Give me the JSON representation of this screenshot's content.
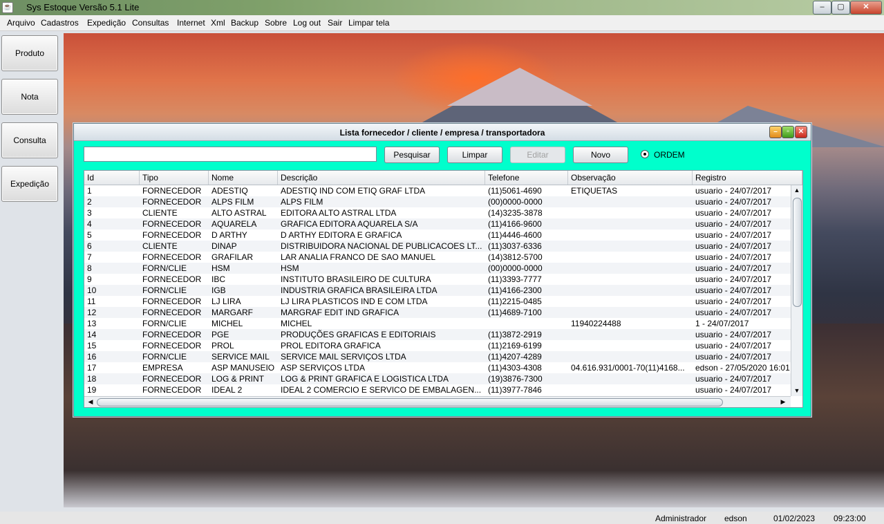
{
  "window": {
    "title": "Sys Estoque Versão 5.1   Lite",
    "icon": "java-icon",
    "controls": {
      "minimize": "–",
      "maximize": "▢",
      "close": "✕"
    }
  },
  "menu": [
    "Arquivo",
    "Cadastros",
    "Expedição",
    "Consultas",
    "Internet",
    "Xml",
    "Backup",
    "Sobre",
    "Log out",
    "Sair",
    "Limpar tela"
  ],
  "sidebar": [
    "Produto",
    "Nota",
    "Consulta",
    "Expedição"
  ],
  "dialog": {
    "title": "Lista fornecedor / cliente / empresa / transportadora",
    "search_value": "",
    "buttons": {
      "pesquisar": "Pesquisar",
      "limpar": "Limpar",
      "editar": "Editar",
      "novo": "Novo"
    },
    "radio_label": "ORDEM",
    "radio_selected": true,
    "background_color": "#00ffcc"
  },
  "table": {
    "columns": [
      "Id",
      "Tipo",
      "Nome",
      "Descrição",
      "Telefone",
      "Observação",
      "Registro"
    ],
    "rows": [
      [
        "1",
        "FORNECEDOR",
        "ADESTIQ",
        "ADESTIQ IND COM ETIQ GRAF LTDA",
        "(11)5061-4690",
        "ETIQUETAS",
        "usuario - 24/07/2017"
      ],
      [
        "2",
        "FORNECEDOR",
        "ALPS FILM",
        "ALPS FILM",
        "(00)0000-0000",
        "",
        "usuario - 24/07/2017"
      ],
      [
        "3",
        "CLIENTE",
        "ALTO ASTRAL",
        "EDITORA ALTO ASTRAL LTDA",
        "(14)3235-3878",
        "",
        "usuario - 24/07/2017"
      ],
      [
        "4",
        "FORNECEDOR",
        "AQUARELA",
        "GRAFICA EDITORA AQUARELA S/A",
        "(11)4166-9600",
        "",
        "usuario - 24/07/2017"
      ],
      [
        "5",
        "FORNECEDOR",
        "D ARTHY",
        "D ARTHY EDITORA E GRAFICA",
        "(11)4446-4600",
        "",
        "usuario - 24/07/2017"
      ],
      [
        "6",
        "CLIENTE",
        "DINAP",
        "DISTRIBUIDORA NACIONAL DE PUBLICACOES LT...",
        "(11)3037-6336",
        "",
        "usuario - 24/07/2017"
      ],
      [
        "7",
        "FORNECEDOR",
        "GRAFILAR",
        "LAR ANALIA FRANCO DE SAO MANUEL",
        "(14)3812-5700",
        "",
        "usuario - 24/07/2017"
      ],
      [
        "8",
        "FORN/CLIE",
        "HSM",
        "HSM",
        "(00)0000-0000",
        "",
        "usuario - 24/07/2017"
      ],
      [
        "9",
        "FORNECEDOR",
        "IBC",
        "INSTITUTO  BRASILEIRO DE CULTURA",
        "(11)3393-7777",
        "",
        "usuario - 24/07/2017"
      ],
      [
        "10",
        "FORN/CLIE",
        "IGB",
        "INDUSTRIA GRAFICA BRASILEIRA LTDA",
        "(11)4166-2300",
        "",
        "usuario - 24/07/2017"
      ],
      [
        "11",
        "FORNECEDOR",
        "LJ LIRA",
        "LJ LIRA  PLASTICOS IND E COM LTDA",
        "(11)2215-0485",
        "",
        "usuario - 24/07/2017"
      ],
      [
        "12",
        "FORNECEDOR",
        "MARGARF",
        "MARGRAF EDIT IND GRAFICA",
        "(11)4689-7100",
        "",
        "usuario - 24/07/2017"
      ],
      [
        "13",
        "FORN/CLIE",
        "MICHEL",
        "MICHEL",
        "",
        "11940224488",
        "1 - 24/07/2017"
      ],
      [
        "14",
        "FORNECEDOR",
        "PGE",
        "PRODUÇÕES GRAFICAS E EDITORIAIS",
        "(11)3872-2919",
        "",
        "usuario - 24/07/2017"
      ],
      [
        "15",
        "FORNECEDOR",
        "PROL",
        "PROL EDITORA GRAFICA",
        "(11)2169-6199",
        "",
        "usuario - 24/07/2017"
      ],
      [
        "16",
        "FORN/CLIE",
        "SERVICE MAIL",
        "SERVICE MAIL SERVIÇOS LTDA",
        "(11)4207-4289",
        "",
        "usuario - 24/07/2017"
      ],
      [
        "17",
        "EMPRESA",
        "ASP MANUSEIO",
        "ASP SERVIÇOS LTDA",
        "(11)4303-4308",
        "04.616.931/0001-70(11)4168...",
        "edson - 27/05/2020 16:01"
      ],
      [
        "18",
        "FORNECEDOR",
        "LOG & PRINT",
        "LOG & PRINT GRAFICA E LOGISTICA LTDA",
        "(19)3876-7300",
        "",
        "usuario - 24/07/2017"
      ],
      [
        "19",
        "FORNECEDOR",
        "IDEAL 2",
        "IDEAL 2 COMERCIO E SERVICO DE EMBALAGEN...",
        "(11)3977-7846",
        "",
        "usuario - 24/07/2017"
      ]
    ]
  },
  "status": {
    "role": "Administrador",
    "user": "edson",
    "date": "01/02/2023",
    "time": "09:23:00"
  }
}
